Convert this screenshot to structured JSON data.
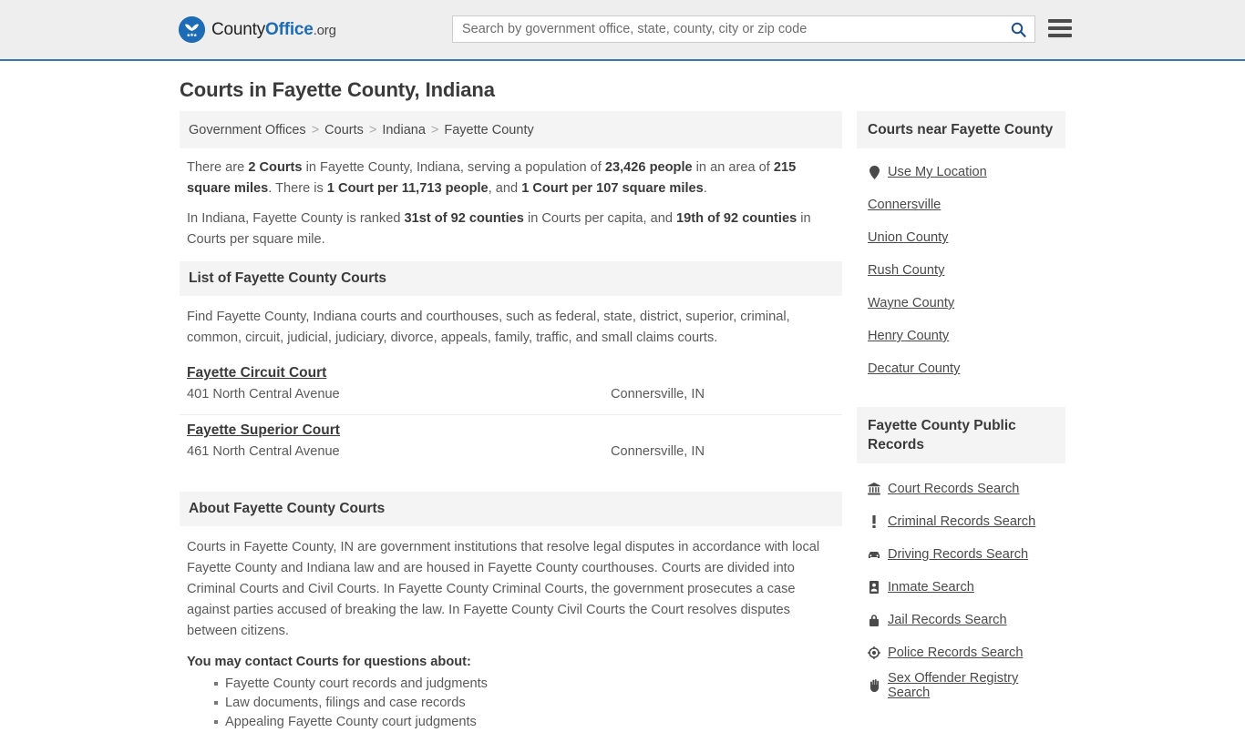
{
  "header": {
    "brand": {
      "part1": "County",
      "part2": "Office",
      "part3": ".org"
    },
    "search": {
      "placeholder": "Search by government office, state, county, city or zip code",
      "value": "",
      "icon": "search-icon"
    },
    "menu_icon": "hamburger-menu-icon",
    "accent_color": "#1d6cb5",
    "border_color": "#3a76ad",
    "background": "#eeeeee"
  },
  "page_title": "Courts in Fayette County, Indiana",
  "breadcrumb": {
    "separator": ">",
    "items": [
      "Government Offices",
      "Courts",
      "Indiana",
      "Fayette County"
    ]
  },
  "intro": {
    "p1_a": "There are ",
    "p1_b1": "2 Courts",
    "p1_c": " in Fayette County, Indiana, serving a population of ",
    "p1_b2": "23,426 people",
    "p1_d": " in an area of ",
    "p1_b3": "215 square miles",
    "p1_e": ". There is ",
    "p1_b4": "1 Court per 11,713 people",
    "p1_f": ", and ",
    "p1_b5": "1 Court per 107 square miles",
    "p1_g": ".",
    "p2_a": "In Indiana, Fayette County is ranked ",
    "p2_b1": "31st of 92 counties",
    "p2_c": " in Courts per capita, and ",
    "p2_b2": "19th of 92 counties",
    "p2_d": " in Courts per square mile."
  },
  "list_section": {
    "heading": "List of Fayette County Courts",
    "description": "Find Fayette County, Indiana courts and courthouses, such as federal, state, district, superior, criminal, common, circuit, judicial, judiciary, divorce, appeals, family, traffic, and small claims courts.",
    "courts": [
      {
        "name": "Fayette Circuit Court",
        "address": "401 North Central Avenue",
        "city": "Connersville, IN"
      },
      {
        "name": "Fayette Superior Court",
        "address": "461 North Central Avenue",
        "city": "Connersville, IN"
      }
    ]
  },
  "about_section": {
    "heading": "About Fayette County Courts",
    "paragraph": "Courts in Fayette County, IN are government institutions that resolve legal disputes in accordance with local Fayette County and Indiana law and are housed in Fayette County courthouses. Courts are divided into Criminal Courts and Civil Courts. In Fayette County Criminal Courts, the government prosecutes a case against parties accused of breaking the law. In Fayette County Civil Courts the Court resolves disputes between citizens.",
    "contact_lead": "You may contact Courts for questions about:",
    "contact_items": [
      "Fayette County court records and judgments",
      "Law documents, filings and case records",
      "Appealing Fayette County court judgments"
    ]
  },
  "sidebar": {
    "nearby": {
      "heading": "Courts near Fayette County",
      "items": [
        {
          "label": "Use My Location",
          "icon": "map-pin-icon"
        },
        {
          "label": "Connersville",
          "icon": ""
        },
        {
          "label": "Union County",
          "icon": ""
        },
        {
          "label": "Rush County",
          "icon": ""
        },
        {
          "label": "Wayne County",
          "icon": ""
        },
        {
          "label": "Henry County",
          "icon": ""
        },
        {
          "label": "Decatur County",
          "icon": ""
        }
      ]
    },
    "records": {
      "heading": "Fayette County Public Records",
      "items": [
        {
          "label": "Court Records Search",
          "icon": "courthouse-icon"
        },
        {
          "label": "Criminal Records Search",
          "icon": "exclamation-icon"
        },
        {
          "label": "Driving Records Search",
          "icon": "car-icon"
        },
        {
          "label": "Inmate Search",
          "icon": "id-badge-icon"
        },
        {
          "label": "Jail Records Search",
          "icon": "lock-icon"
        },
        {
          "label": "Police Records Search",
          "icon": "police-badge-icon"
        },
        {
          "label": "Sex Offender Registry Search",
          "icon": "hand-icon"
        }
      ]
    }
  }
}
